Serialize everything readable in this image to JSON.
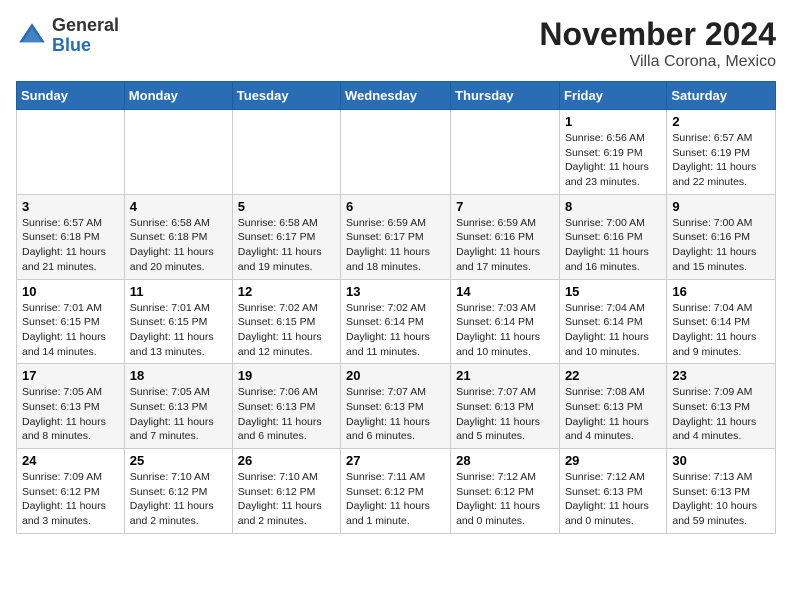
{
  "logo": {
    "general": "General",
    "blue": "Blue"
  },
  "title": "November 2024",
  "location": "Villa Corona, Mexico",
  "days_header": [
    "Sunday",
    "Monday",
    "Tuesday",
    "Wednesday",
    "Thursday",
    "Friday",
    "Saturday"
  ],
  "weeks": [
    [
      {
        "day": "",
        "info": ""
      },
      {
        "day": "",
        "info": ""
      },
      {
        "day": "",
        "info": ""
      },
      {
        "day": "",
        "info": ""
      },
      {
        "day": "",
        "info": ""
      },
      {
        "day": "1",
        "info": "Sunrise: 6:56 AM\nSunset: 6:19 PM\nDaylight: 11 hours and 23 minutes."
      },
      {
        "day": "2",
        "info": "Sunrise: 6:57 AM\nSunset: 6:19 PM\nDaylight: 11 hours and 22 minutes."
      }
    ],
    [
      {
        "day": "3",
        "info": "Sunrise: 6:57 AM\nSunset: 6:18 PM\nDaylight: 11 hours and 21 minutes."
      },
      {
        "day": "4",
        "info": "Sunrise: 6:58 AM\nSunset: 6:18 PM\nDaylight: 11 hours and 20 minutes."
      },
      {
        "day": "5",
        "info": "Sunrise: 6:58 AM\nSunset: 6:17 PM\nDaylight: 11 hours and 19 minutes."
      },
      {
        "day": "6",
        "info": "Sunrise: 6:59 AM\nSunset: 6:17 PM\nDaylight: 11 hours and 18 minutes."
      },
      {
        "day": "7",
        "info": "Sunrise: 6:59 AM\nSunset: 6:16 PM\nDaylight: 11 hours and 17 minutes."
      },
      {
        "day": "8",
        "info": "Sunrise: 7:00 AM\nSunset: 6:16 PM\nDaylight: 11 hours and 16 minutes."
      },
      {
        "day": "9",
        "info": "Sunrise: 7:00 AM\nSunset: 6:16 PM\nDaylight: 11 hours and 15 minutes."
      }
    ],
    [
      {
        "day": "10",
        "info": "Sunrise: 7:01 AM\nSunset: 6:15 PM\nDaylight: 11 hours and 14 minutes."
      },
      {
        "day": "11",
        "info": "Sunrise: 7:01 AM\nSunset: 6:15 PM\nDaylight: 11 hours and 13 minutes."
      },
      {
        "day": "12",
        "info": "Sunrise: 7:02 AM\nSunset: 6:15 PM\nDaylight: 11 hours and 12 minutes."
      },
      {
        "day": "13",
        "info": "Sunrise: 7:02 AM\nSunset: 6:14 PM\nDaylight: 11 hours and 11 minutes."
      },
      {
        "day": "14",
        "info": "Sunrise: 7:03 AM\nSunset: 6:14 PM\nDaylight: 11 hours and 10 minutes."
      },
      {
        "day": "15",
        "info": "Sunrise: 7:04 AM\nSunset: 6:14 PM\nDaylight: 11 hours and 10 minutes."
      },
      {
        "day": "16",
        "info": "Sunrise: 7:04 AM\nSunset: 6:14 PM\nDaylight: 11 hours and 9 minutes."
      }
    ],
    [
      {
        "day": "17",
        "info": "Sunrise: 7:05 AM\nSunset: 6:13 PM\nDaylight: 11 hours and 8 minutes."
      },
      {
        "day": "18",
        "info": "Sunrise: 7:05 AM\nSunset: 6:13 PM\nDaylight: 11 hours and 7 minutes."
      },
      {
        "day": "19",
        "info": "Sunrise: 7:06 AM\nSunset: 6:13 PM\nDaylight: 11 hours and 6 minutes."
      },
      {
        "day": "20",
        "info": "Sunrise: 7:07 AM\nSunset: 6:13 PM\nDaylight: 11 hours and 6 minutes."
      },
      {
        "day": "21",
        "info": "Sunrise: 7:07 AM\nSunset: 6:13 PM\nDaylight: 11 hours and 5 minutes."
      },
      {
        "day": "22",
        "info": "Sunrise: 7:08 AM\nSunset: 6:13 PM\nDaylight: 11 hours and 4 minutes."
      },
      {
        "day": "23",
        "info": "Sunrise: 7:09 AM\nSunset: 6:13 PM\nDaylight: 11 hours and 4 minutes."
      }
    ],
    [
      {
        "day": "24",
        "info": "Sunrise: 7:09 AM\nSunset: 6:12 PM\nDaylight: 11 hours and 3 minutes."
      },
      {
        "day": "25",
        "info": "Sunrise: 7:10 AM\nSunset: 6:12 PM\nDaylight: 11 hours and 2 minutes."
      },
      {
        "day": "26",
        "info": "Sunrise: 7:10 AM\nSunset: 6:12 PM\nDaylight: 11 hours and 2 minutes."
      },
      {
        "day": "27",
        "info": "Sunrise: 7:11 AM\nSunset: 6:12 PM\nDaylight: 11 hours and 1 minute."
      },
      {
        "day": "28",
        "info": "Sunrise: 7:12 AM\nSunset: 6:12 PM\nDaylight: 11 hours and 0 minutes."
      },
      {
        "day": "29",
        "info": "Sunrise: 7:12 AM\nSunset: 6:13 PM\nDaylight: 11 hours and 0 minutes."
      },
      {
        "day": "30",
        "info": "Sunrise: 7:13 AM\nSunset: 6:13 PM\nDaylight: 10 hours and 59 minutes."
      }
    ]
  ]
}
